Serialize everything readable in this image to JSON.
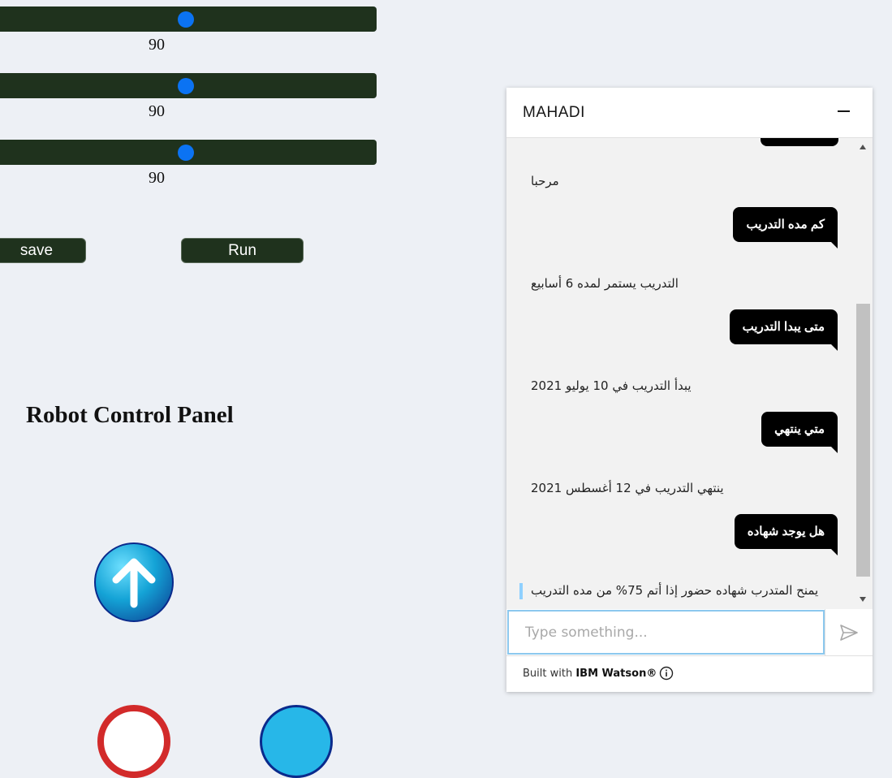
{
  "sliders": [
    {
      "value": "90",
      "level_fraction": 0.5
    },
    {
      "value": "90",
      "level_fraction": 0.5
    },
    {
      "value": "90",
      "level_fraction": 0.5
    }
  ],
  "buttons": {
    "save": "save",
    "run": "Run"
  },
  "panel": {
    "title": "Robot Control Panel"
  },
  "icons": {
    "forward": "arrow-up-icon",
    "send": "send-icon",
    "info": "info-icon",
    "minimize": "minimize-icon"
  },
  "colors": {
    "control_dark_green": "#1f321d",
    "slider_thumb": "#0b73f3",
    "page_background": "#edf0f5",
    "user_bubble": "#000000",
    "input_focus_border": "#8cc8ee"
  },
  "chat": {
    "title": "MAHADI",
    "messages": [
      {
        "from": "bot",
        "text": "مرحبا"
      },
      {
        "from": "user",
        "text": "كم مده التدريب"
      },
      {
        "from": "bot",
        "text": "التدريب يستمر لمده 6 أسابيع"
      },
      {
        "from": "user",
        "text": "متى يبدا التدريب"
      },
      {
        "from": "bot",
        "text": "يبدأ التدريب في 10 يوليو 2021"
      },
      {
        "from": "user",
        "text": "متي ينتهي"
      },
      {
        "from": "bot",
        "text": "ينتهي التدريب في 12 أغسطس 2021"
      },
      {
        "from": "user",
        "text": "هل يوجد شهاده"
      },
      {
        "from": "bot",
        "text": "يمنح المتدرب شهاده حضور إذا أتم 75% من مده التدريب"
      }
    ],
    "input_placeholder": "Type something...",
    "footer_prefix": "Built with ",
    "footer_brand": "IBM Watson®"
  }
}
